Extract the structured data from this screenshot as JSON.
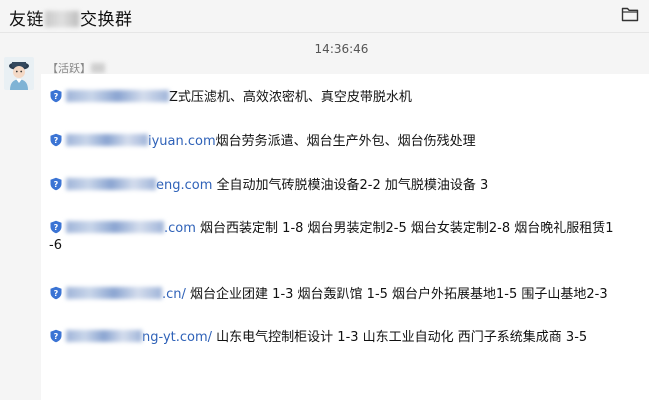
{
  "header": {
    "title_prefix": "友链",
    "title_suffix": "交换群",
    "folder_icon": "folder-icon"
  },
  "chat": {
    "timestamp": "14:36:46",
    "sender_tag": "【活跃】",
    "messages": [
      {
        "link": "",
        "text": "Z式压滤机、高效浓密机、真空皮带脱水机"
      },
      {
        "link": "iyuan.com",
        "text": "烟台劳务派遣、烟台生产外包、烟台伤残处理"
      },
      {
        "link": "eng.com",
        "text": "  全自动加气砖脱模油设备2-2  加气脱模油设备  3"
      },
      {
        "link": ".com",
        "text": "  烟台西装定制 1-8   烟台男装定制2-5    烟台女装定制2-8     烟台晚礼服租赁1",
        "text2": "-6"
      },
      {
        "link": ".cn/",
        "text": "  烟台企业团建  1-3   烟台轰趴馆  1-5     烟台户外拓展基地1-5   围子山基地2-3"
      },
      {
        "link": "ng-yt.com/",
        "text": "  山东电气控制柜设计 1-3     山东工业自动化    西门子系统集成商 3-5"
      }
    ]
  },
  "colors": {
    "link": "#2f62b8",
    "shield": "#3b74d4",
    "bubble": "#ffffff",
    "background": "#f5f5f5"
  }
}
